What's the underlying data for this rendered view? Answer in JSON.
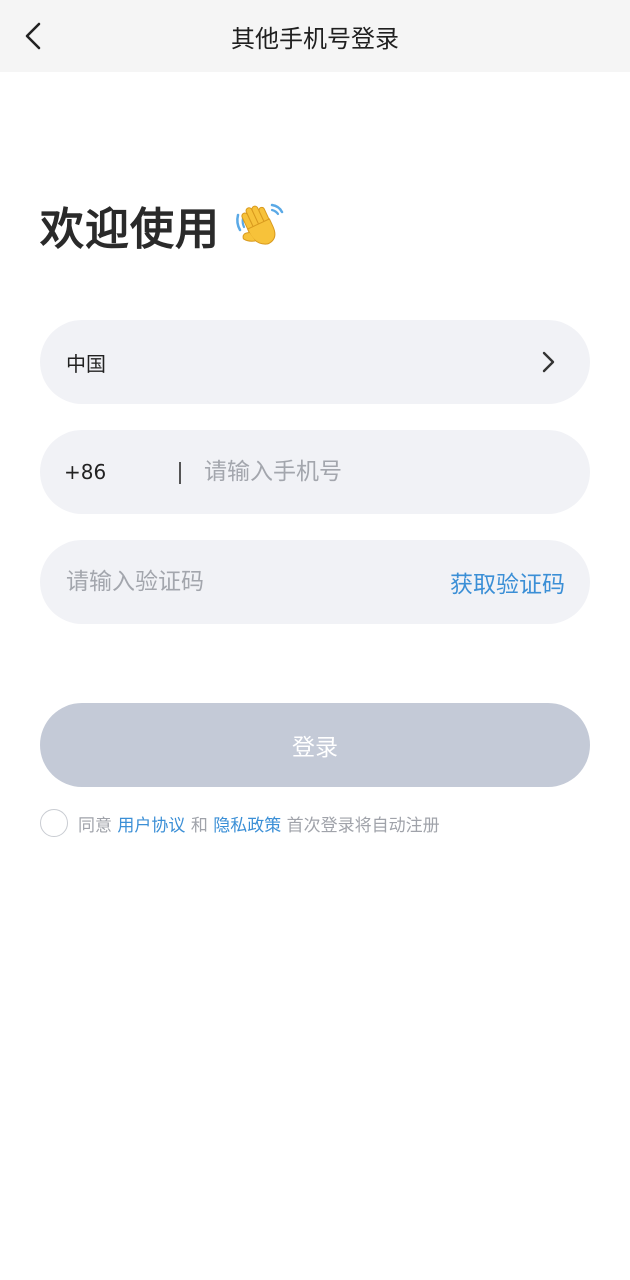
{
  "header": {
    "title": "其他手机号登录",
    "back_icon": "chevron-left-icon"
  },
  "welcome": {
    "text": "欢迎使用",
    "emoji": "👋"
  },
  "country_field": {
    "value": "中国",
    "icon": "chevron-right-icon"
  },
  "phone_field": {
    "prefix": "+86",
    "placeholder": "请输入手机号"
  },
  "code_field": {
    "placeholder": "请输入验证码",
    "get_code_label": "获取验证码"
  },
  "login_button": {
    "label": "登录"
  },
  "agreement": {
    "prefix": "同意",
    "user_agreement": "用户协议",
    "and": "和",
    "privacy_policy": "隐私政策",
    "suffix": "首次登录将自动注册"
  },
  "colors": {
    "link": "#3b8fd6",
    "button_disabled": "#c4cad7",
    "field_bg": "#f1f2f6",
    "header_bg": "#f5f5f5"
  }
}
